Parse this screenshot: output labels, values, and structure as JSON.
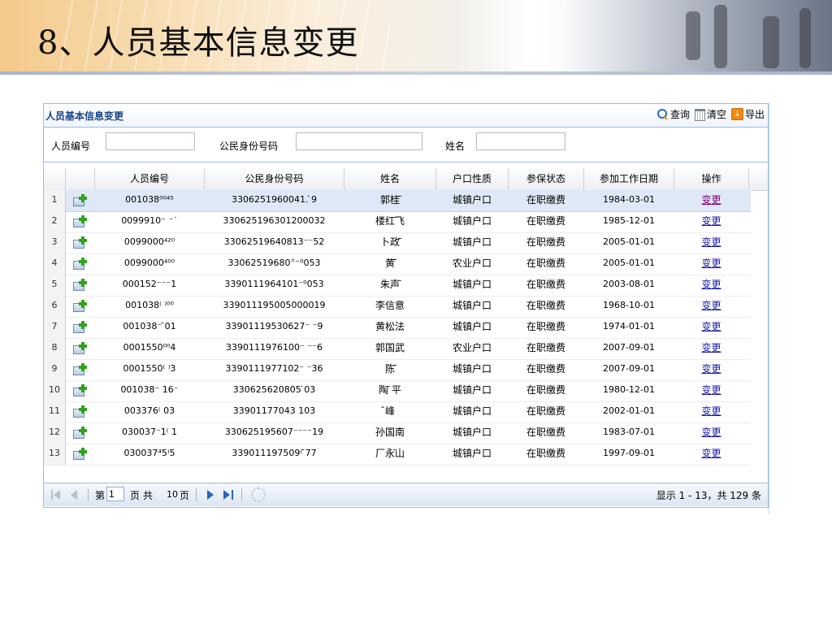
{
  "slide": {
    "title": "8、人员基本信息变更"
  },
  "panel": {
    "title": "人员基本信息变更",
    "tools": {
      "query": "查询",
      "clear": "清空",
      "export": "导出"
    }
  },
  "search": {
    "fields": [
      {
        "label": "人员编号",
        "value": ""
      },
      {
        "label": "公民身份号码",
        "value": ""
      },
      {
        "label": "姓名",
        "value": ""
      }
    ]
  },
  "grid": {
    "columns": [
      "人员编号",
      "公民身份号码",
      "姓名",
      "户口性质",
      "参保状态",
      "参加工作日期",
      "操作"
    ],
    "rows": [
      {
        "no": "1",
        "id": "001038⁰⁰⁴⁵",
        "idcard": "3306251960041.  ̀9",
        "name": "郭桂̄̄",
        "hukou": "城镇户口",
        "status": "在职缴费",
        "date": "1984-03-01",
        "action": "变更"
      },
      {
        "no": "2",
        "id": "0099910⁻ ⁻˙",
        "idcard": "330625196301200032",
        "name": "楼红̄飞",
        "hukou": "城镇户口",
        "status": "在职缴费",
        "date": "1985-12-01",
        "action": "变更"
      },
      {
        "no": "3",
        "id": "0099000⁴²⁰",
        "idcard": "33062519640813⁻⁻52",
        "name": "卜政̄̄",
        "hukou": "城镇户口",
        "status": "在职缴费",
        "date": "2005-01-01",
        "action": "变更"
      },
      {
        "no": "4",
        "id": "0099000⁴⁰⁰",
        "idcard": "33062519680⁻̄⁻⁰053",
        "name": "黄̄̄̄",
        "hukou": "农业户口",
        "status": "在职缴费",
        "date": "2005-01-01",
        "action": "变更"
      },
      {
        "no": "5",
        "id": "000152⁻⁻⁻1",
        "idcard": "3390111964101⁻⁰053",
        "name": "朱声̄",
        "hukou": "城镇户口",
        "status": "在职缴费",
        "date": "2003-08-01",
        "action": "变更"
      },
      {
        "no": "6",
        "id": "001038⁽ ⁾⁰⁰",
        "idcard": "339011195005000019",
        "name": "李信意",
        "hukou": "城镇户口",
        "status": "在职缴费",
        "date": "1968-10-01",
        "action": "变更"
      },
      {
        "no": "7",
        "id": "001038⁻ ̄01",
        "idcard": "33901119530627⁻ ⁻9",
        "name": "黄松法",
        "hukou": "城镇户口",
        "status": "在职缴费",
        "date": "1974-01-01",
        "action": "变更"
      },
      {
        "no": "8",
        "id": "0001550⁰⁰4",
        "idcard": "3390111976100⁻ ⁻⁻6",
        "name": "郭国武",
        "hukou": "农业户口",
        "status": "在职缴费",
        "date": "2007-09-01",
        "action": "变更"
      },
      {
        "no": "9",
        "id": "0001550⁽ ⁾3",
        "idcard": "3390111977102⁻ ⁻36",
        "name": "陈̄̄",
        "hukou": "城镇户口",
        "status": "在职缴费",
        "date": "2007-09-01",
        "action": "变更"
      },
      {
        "no": "10",
        "id": "001038⁻ 16⁻",
        "idcard": "330625620805 ̇03",
        "name": "陶̄ 平",
        "hukou": "城镇户口",
        "status": "在职缴费",
        "date": "1980-12-01",
        "action": "变更"
      },
      {
        "no": "11",
        "id": "003376⁽ 03",
        "idcard": "33901177043  103",
        "name": "̄峰",
        "hukou": "城镇户口",
        "status": "在职缴费",
        "date": "2002-01-01",
        "action": "变更"
      },
      {
        "no": "12",
        "id": "030037⁻1⁽ 1",
        "idcard": "330625195607⁻⁻⁻⁻19",
        "name": "孙国南",
        "hukou": "城镇户口",
        "status": "在职缴费",
        "date": "1983-07-01",
        "action": "变更"
      },
      {
        "no": "13",
        "id": "030037⁴5⁾5",
        "idcard": "339011197509⁽  ̄77",
        "name": "厂永̄山",
        "hukou": "城镇户口",
        "status": "在职缴费",
        "date": "1997-09-01",
        "action": "变更"
      }
    ]
  },
  "pager": {
    "page_prefix": "第",
    "page_value": "1",
    "page_mid": "页 共",
    "total_pages": "10",
    "page_suffix": "页",
    "display": "显示 1 - 13，共 129 条"
  }
}
